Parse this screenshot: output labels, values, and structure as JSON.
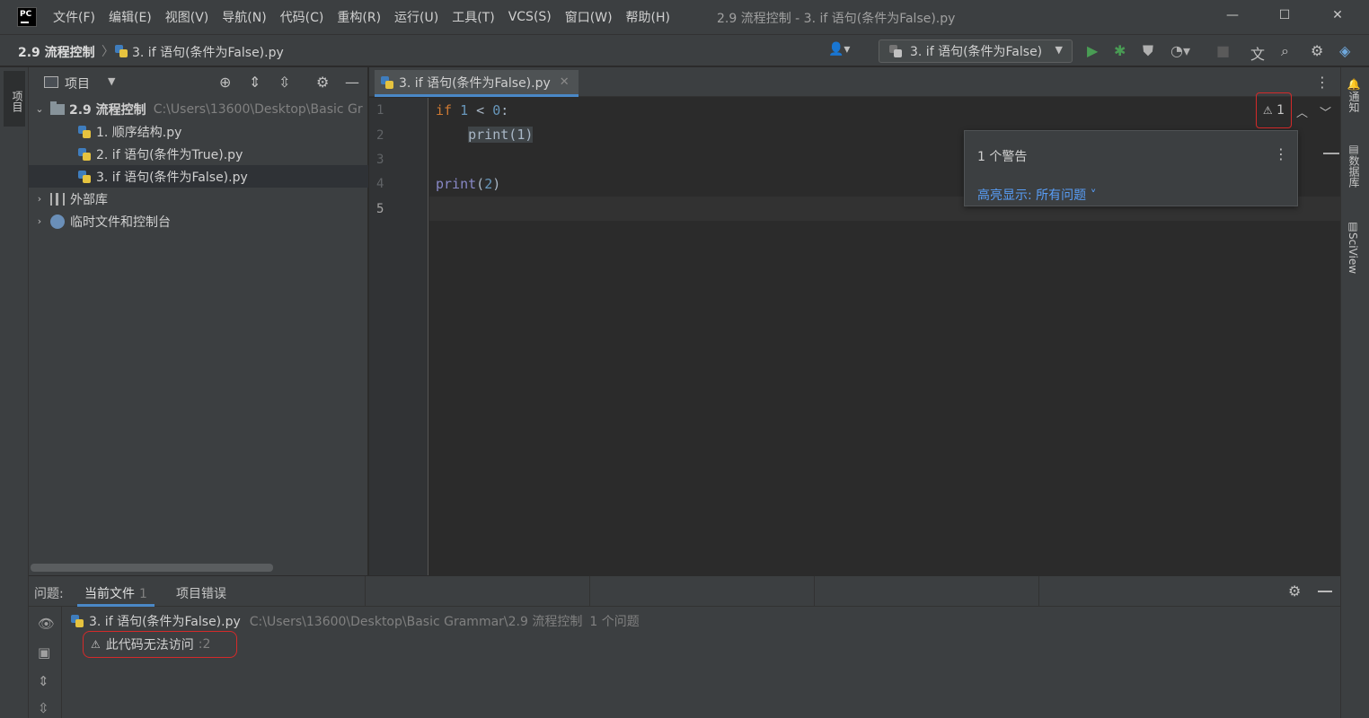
{
  "window": {
    "title": "2.9 流程控制 - 3. if 语句(条件为False).py",
    "controls": {
      "minimize": "—",
      "maximize": "☐",
      "close": "✕"
    }
  },
  "menu": [
    "文件(F)",
    "编辑(E)",
    "视图(V)",
    "导航(N)",
    "代码(C)",
    "重构(R)",
    "运行(U)",
    "工具(T)",
    "VCS(S)",
    "窗口(W)",
    "帮助(H)"
  ],
  "breadcrumb": {
    "project": "2.9 流程控制",
    "separator": "〉",
    "file": "3. if 语句(条件为False).py"
  },
  "toolbar": {
    "run_config": "3. if 语句(条件为False)",
    "icons": [
      "user-icon",
      "run-icon",
      "debug-icon",
      "coverage-icon",
      "profile-icon",
      "stop-icon",
      "translate-icon",
      "search-icon",
      "settings-icon",
      "plugin-icon"
    ]
  },
  "left_strip": {
    "tab": "项目"
  },
  "right_strip": {
    "notifications": "通知",
    "database": "数据库",
    "sciview": "SciView"
  },
  "project": {
    "title": "项目",
    "root": {
      "name": "2.9 流程控制",
      "path": "C:\\Users\\13600\\Desktop\\Basic Gr"
    },
    "files": [
      "1. 顺序结构.py",
      "2. if 语句(条件为True).py",
      "3. if 语句(条件为False).py"
    ],
    "selected_index": 2,
    "external_libs": "外部库",
    "scratches": "临时文件和控制台"
  },
  "editor": {
    "tab": "3. if 语句(条件为False).py",
    "line_numbers": [
      "1",
      "2",
      "3",
      "4",
      "5"
    ],
    "code": {
      "l1_kw": "if",
      "l1_n1": "1",
      "l1_op": " < ",
      "l1_n0": "0",
      "l1_end": ":",
      "l2_indent": "    ",
      "l2_fn": "print",
      "l2_paren_open": "(",
      "l2_arg": "1",
      "l2_paren_close": ")",
      "l4_fn": "print",
      "l4_paren_open": "(",
      "l4_arg": "2",
      "l4_paren_close": ")"
    },
    "warning_count": "1",
    "popup": {
      "title": "1 个警告",
      "link": "高亮显示: 所有问题 ˅"
    }
  },
  "problems": {
    "label": "问题:",
    "tab_current": "当前文件",
    "tab_current_count": "1",
    "tab_project": "项目错误",
    "file": "3. if 语句(条件为False).py",
    "path": "C:\\Users\\13600\\Desktop\\Basic Grammar\\2.9 流程控制",
    "count_text": "1 个问题",
    "item": "此代码无法访问",
    "item_line": ":2"
  },
  "colors": {
    "accent_blue": "#4a88c7",
    "highlight_red": "#d42a2a",
    "keyword": "#cc7832",
    "number": "#6897bb",
    "builtin": "#8888c6",
    "link": "#589df6"
  }
}
